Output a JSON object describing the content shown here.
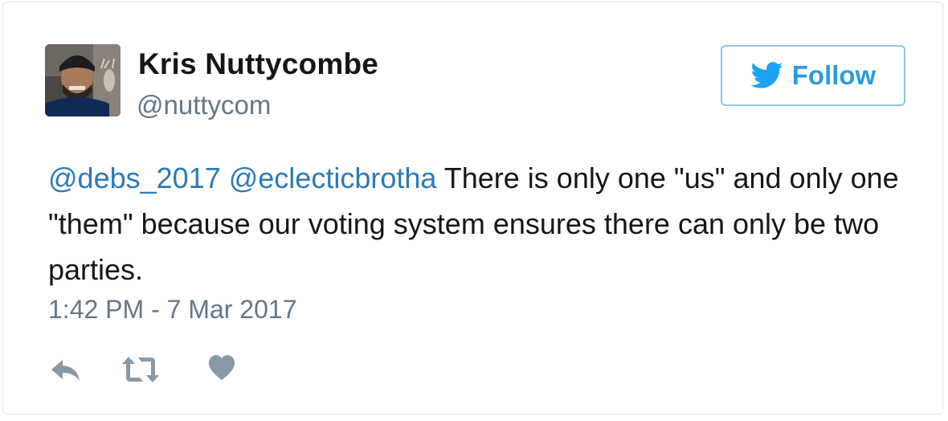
{
  "author": {
    "name": "Kris Nuttycombe",
    "handle": "@nuttycom"
  },
  "follow": {
    "label": "Follow",
    "icon": "twitter-bird-icon"
  },
  "tweet": {
    "mention_1": "@debs_2017",
    "mention_2": "@eclecticbrotha",
    "body": " There is only one \"us\" and only one \"them\" because our voting system ensures there can only be two parties."
  },
  "timestamp": "1:42 PM - 7 Mar 2017",
  "actions": {
    "reply_icon": "reply-icon",
    "retweet_icon": "retweet-icon",
    "like_icon": "heart-icon"
  },
  "colors": {
    "accent": "#1da1f2",
    "link": "#2b7bb9",
    "muted": "#657786",
    "text": "#14171a",
    "icon": "#8899a6"
  }
}
